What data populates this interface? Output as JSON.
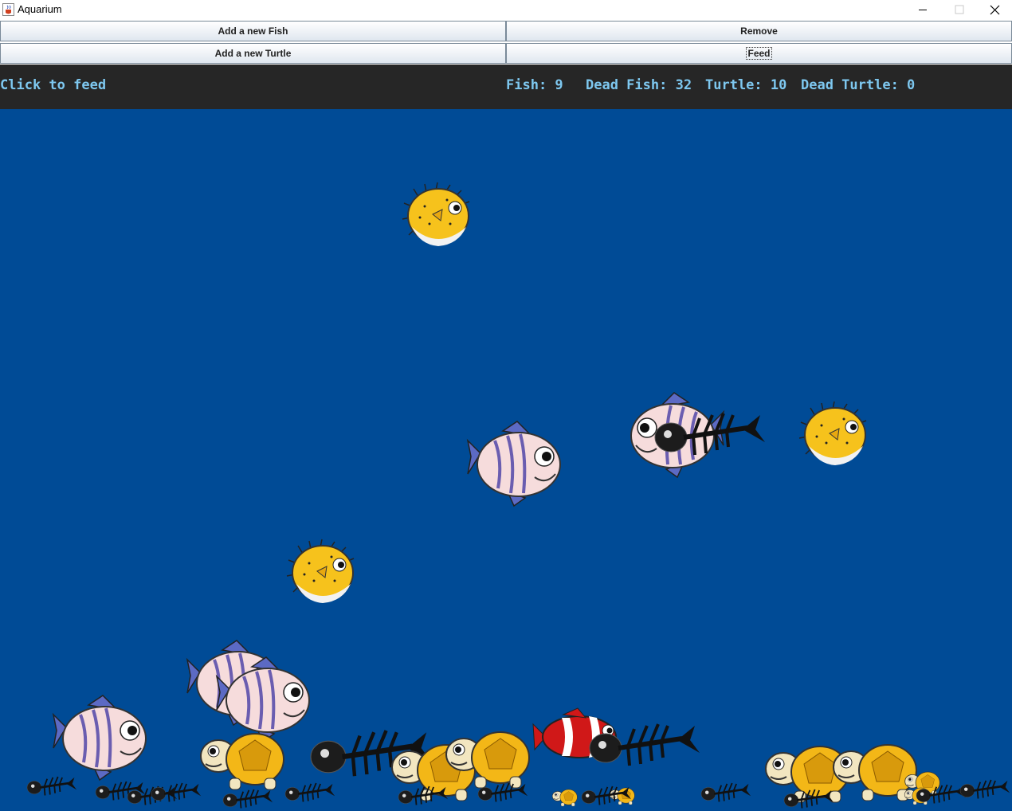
{
  "window": {
    "title": "Aquarium",
    "icon": "java-cup-icon"
  },
  "controls": {
    "add_fish": "Add a new Fish",
    "remove": "Remove",
    "add_turtle": "Add a new Turtle",
    "feed": "Feed"
  },
  "status": {
    "hint": "Click to feed",
    "fish": "Fish: 9",
    "dead_fish": "Dead Fish: 32",
    "turtle": "Turtle: 10",
    "dead_turtle": "Dead Turtle: 0"
  },
  "colors": {
    "water": "#004b96",
    "status_bg": "#262626",
    "status_text": "#7ec8f0"
  }
}
